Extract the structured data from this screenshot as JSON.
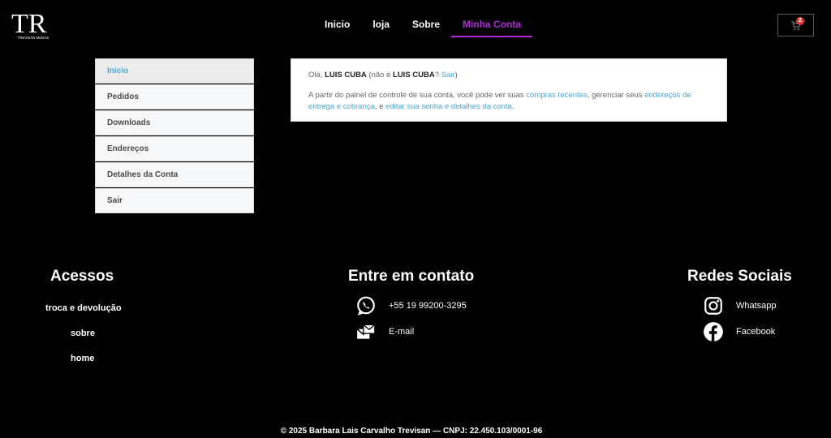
{
  "brand": {
    "logo_text": "TR",
    "logo_sub": "TREVISAN MODAS"
  },
  "nav": [
    {
      "label": "Inicio"
    },
    {
      "label": "loja"
    },
    {
      "label": "Sobre"
    },
    {
      "label": "Minha Conta",
      "active": true
    }
  ],
  "cart": {
    "count": "2",
    "icon": "cart-icon",
    "badge_color": "#e03a3a"
  },
  "colors": {
    "accent": "#b22bd8",
    "link": "#4aa7d6",
    "background": "#000000"
  },
  "sidebar": {
    "items": [
      {
        "label": "Inicio",
        "active": true
      },
      {
        "label": "Pedidos"
      },
      {
        "label": "Downloads"
      },
      {
        "label": "Endereços"
      },
      {
        "label": "Detalhes da Conta"
      },
      {
        "label": "Sair"
      }
    ]
  },
  "dashboard": {
    "greeting_prefix": "Olá, ",
    "user": "LUIS CUBA",
    "not_you_prefix": " (não é ",
    "not_you_user": "LUIS CUBA",
    "question": "? ",
    "logout_link": "Sair",
    "close_paren": ")",
    "intro": "A partir do painel de controle de sua conta, você pode ver suas ",
    "recent_orders_link": "compras recentes",
    "manage_text": ", gerenciar seus ",
    "addresses_link": "endereços de entrega e cobrança",
    "and_text": ", e ",
    "edit_link": "editar sua senha e detalhes da conta",
    "end": "."
  },
  "footer": {
    "access": {
      "title": "Acessos",
      "links": [
        "troca e devolução",
        "sobre",
        "home"
      ]
    },
    "contact": {
      "title": "Entre em contato",
      "phone": "+55 19 99200-3295",
      "phone_icon": "whatsapp-icon",
      "email": "E-mail",
      "email_icon": "email-icon"
    },
    "social": {
      "title": "Redes Sociais",
      "whatsapp": "Whatsapp",
      "whatsapp_icon": "instagram-icon",
      "facebook": "Facebook",
      "facebook_icon": "facebook-icon"
    },
    "copyright": "© 2025 Barbara Lais Carvalho Trevisan — CNPJ: 22.450.103/0001-96"
  }
}
